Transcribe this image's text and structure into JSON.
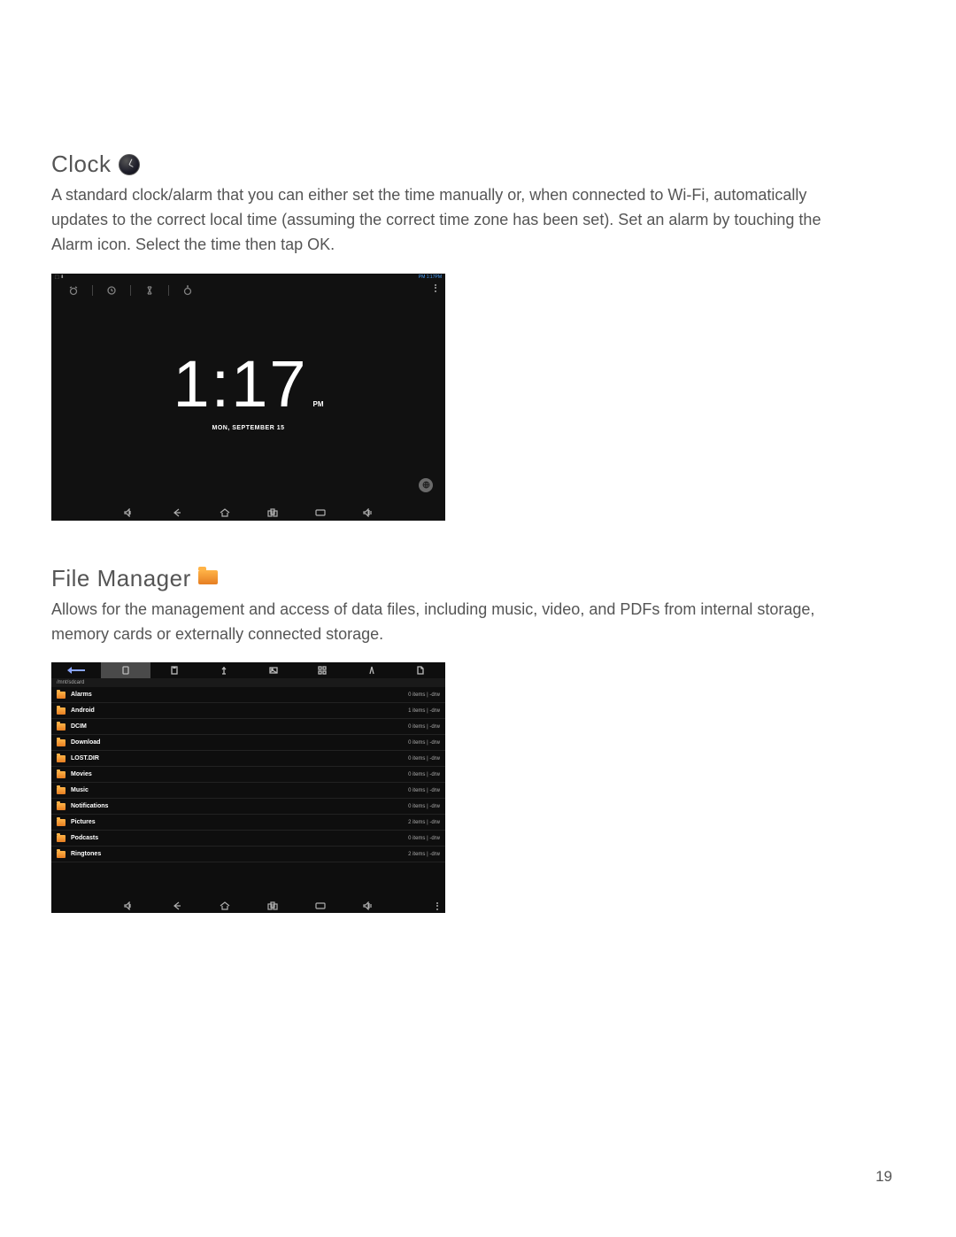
{
  "sections": {
    "clock": {
      "title": "Clock",
      "body": "A standard clock/alarm that you can either set the time manually or, when connected to Wi-Fi, automatically updates to the correct local time (assuming the correct time zone has been set). Set an alarm by touching the Alarm icon. Select the time then tap OK."
    },
    "filemgr": {
      "title": "File Manager",
      "body": "Allows for the management and access of data files, including music, video, and PDFs from internal storage, memory cards or externally connected storage."
    }
  },
  "clock_app": {
    "status_left": "⬚ ⬇",
    "status_right": "PM 1:17PM",
    "time": "1:17",
    "ampm": "PM",
    "date": "MON, SEPTEMBER 15"
  },
  "file_manager": {
    "path": "/mnt/sdcard",
    "rows": [
      {
        "name": "Alarms",
        "meta": "0 items | -drw"
      },
      {
        "name": "Android",
        "meta": "1 items | -drw"
      },
      {
        "name": "DCIM",
        "meta": "0 items | -drw"
      },
      {
        "name": "Download",
        "meta": "0 items | -drw"
      },
      {
        "name": "LOST.DIR",
        "meta": "0 items | -drw"
      },
      {
        "name": "Movies",
        "meta": "0 items | -drw"
      },
      {
        "name": "Music",
        "meta": "0 items | -drw"
      },
      {
        "name": "Notifications",
        "meta": "0 items | -drw"
      },
      {
        "name": "Pictures",
        "meta": "2 items | -drw"
      },
      {
        "name": "Podcasts",
        "meta": "0 items | -drw"
      },
      {
        "name": "Ringtones",
        "meta": "2 items | -drw"
      }
    ]
  },
  "page_number": "19"
}
